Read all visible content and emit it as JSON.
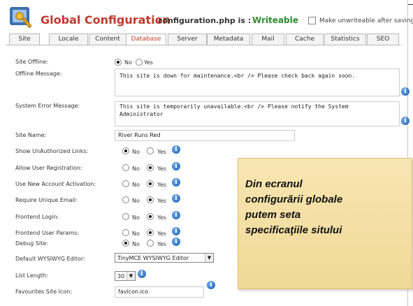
{
  "header": {
    "title": "Global Configuration",
    "file": "configuration.php is :",
    "status": "Writeable",
    "unwritable_label": "Make unwriteable after saving"
  },
  "tabs": [
    "Site",
    "Locale",
    "Content",
    "Database",
    "Server",
    "Metadata",
    "Mail",
    "Cache",
    "Statistics",
    "SEO"
  ],
  "active_tab": "Database",
  "radio_labels": {
    "no": "No",
    "yes": "Yes"
  },
  "fields": {
    "site_offline": {
      "label": "Site Offline:",
      "value": "No"
    },
    "offline_message": {
      "label": "Offline Message:",
      "value": "This site is down for maintenance.<br /> Please check back again soon."
    },
    "system_error": {
      "label": "System Error Message:",
      "line1": "This site is temporarily unavailable.<br /> Please notify the System",
      "line2": "Administrator"
    },
    "site_name": {
      "label": "Site Name:",
      "value": "River Runs Red"
    },
    "show_unauth": {
      "label": "Show UnAuthorized Links:",
      "value": "No"
    },
    "allow_reg": {
      "label": "Allow User Registration:",
      "value": "Yes"
    },
    "new_activation": {
      "label": "Use New Account Activation:",
      "value": "Yes"
    },
    "unique_email": {
      "label": "Require Unique Email:",
      "value": "Yes"
    },
    "frontend_login": {
      "label": "Frontend Login:",
      "value": "Yes"
    },
    "frontend_params": {
      "label": "Frontend User Params:",
      "value": "Yes"
    },
    "debug": {
      "label": "Debug Site:",
      "value": "No"
    },
    "editor": {
      "label": "Default WYSIWYG Editor:",
      "value": "TinyMCE WYSIWYG Editor"
    },
    "list_length": {
      "label": "List Length:",
      "value": "30"
    },
    "favicon": {
      "label": "Favourites Site Icon:",
      "value": "favicon.ico"
    }
  },
  "callout": {
    "lines": [
      "Din ecranul",
      "configurării globale",
      "putem seta",
      "specificaţiile sitului"
    ]
  },
  "icons": {
    "info": "info-icon",
    "logo": "config-logo-icon",
    "select": "chevron-down-icon"
  },
  "colors": {
    "title": "#c0392b",
    "status": "#2e8b2e",
    "info": "#1b5fb4",
    "background": "#f3c56b"
  }
}
